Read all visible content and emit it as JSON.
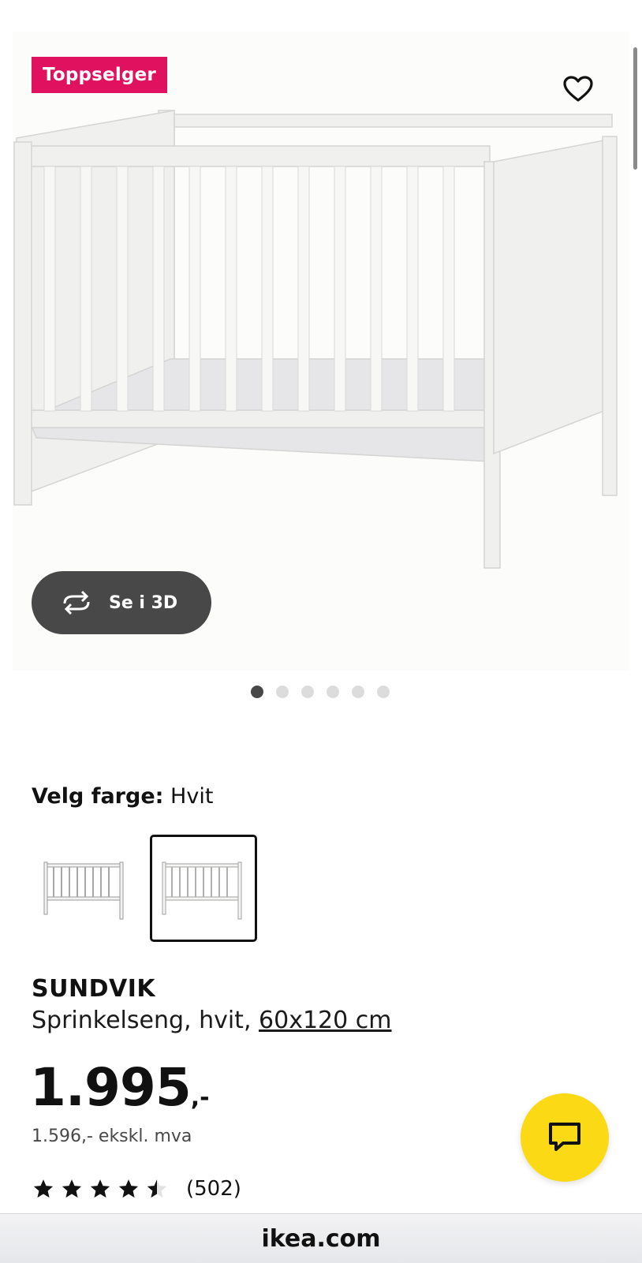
{
  "badge": {
    "label": "Toppselger"
  },
  "gallery": {
    "view_3d_label": "Se i 3D",
    "dot_count": 6,
    "active_dot": 0
  },
  "color": {
    "label": "Velg farge:",
    "value": "Hvit"
  },
  "product": {
    "name": "SUNDVIK",
    "description": "Sprinkelseng, hvit,",
    "size": "60x120 cm"
  },
  "price": {
    "amount": "1.995",
    "suffix": ",-",
    "ex_vat": "1.596,- ekskl. mva"
  },
  "rating": {
    "value": 4.5,
    "max": 5,
    "count": "(502)"
  },
  "browser": {
    "url": "ikea.com"
  },
  "colors": {
    "badge": "#e0115f",
    "chat": "#fbd914",
    "button_3d": "#484848"
  },
  "icons": {
    "favorite": "heart-outline-icon",
    "view_3d": "rotate-icon",
    "chat": "chat-bubble-icon",
    "star": "star-icon"
  }
}
